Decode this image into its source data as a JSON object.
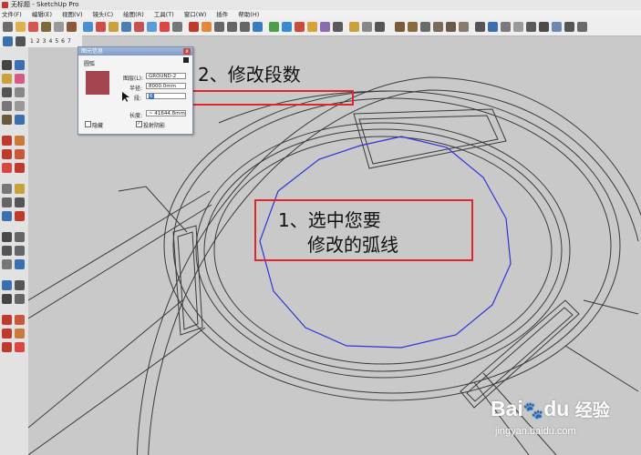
{
  "window": {
    "title": "无标题 - SketchUp Pro"
  },
  "menu": [
    "文件(F)",
    "编辑(E)",
    "视图(V)",
    "镜头(C)",
    "绘图(R)",
    "工具(T)",
    "窗口(W)",
    "插件",
    "帮助(H)"
  ],
  "scene_tabs": [
    "1",
    "2",
    "3",
    "4",
    "5",
    "6",
    "7"
  ],
  "entity_info": {
    "title": "图元信息",
    "type": "圆弧",
    "layer_label": "图层(L):",
    "layer_value": "GROUND-2",
    "radius_label": "半径:",
    "radius_value": "8000.0mm",
    "segments_label": "段:",
    "segments_value": "6",
    "length_label": "长度:",
    "length_value": "~ 41644.8mm",
    "hidden_label": "隐藏",
    "cast_shadow_label": "投射阴影",
    "close_glyph": "x"
  },
  "annotations": {
    "step2": "2、修改段数",
    "step1_line1": "1、选中您要",
    "step1_line2": "修改的弧线"
  },
  "watermark": {
    "brand": "Bai",
    "brand2": "du",
    "suffix": "经验",
    "url": "jingyan.baidu.com"
  },
  "colors": {
    "highlight_red": "#e0262a",
    "selection_blue": "#2a35d6",
    "swatch": "#a5454f"
  }
}
